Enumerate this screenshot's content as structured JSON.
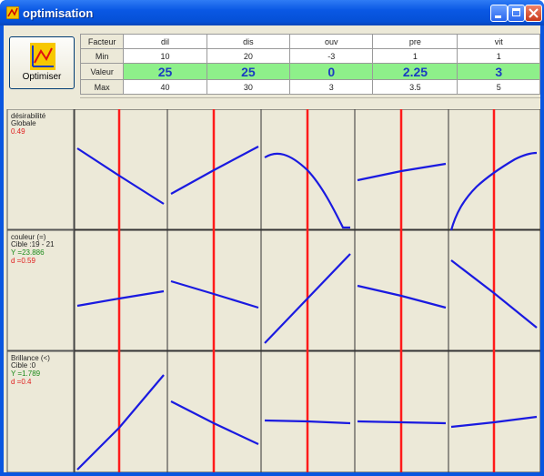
{
  "window": {
    "title": "optimisation"
  },
  "optimise_button": {
    "label": "Optimiser"
  },
  "table": {
    "row_headers": {
      "factor": "Facteur",
      "min": "Min",
      "value": "Valeur",
      "max": "Max"
    },
    "columns": [
      {
        "factor": "dil",
        "min": "10",
        "value": "25",
        "max": "40"
      },
      {
        "factor": "dis",
        "min": "20",
        "value": "25",
        "max": "30"
      },
      {
        "factor": "ouv",
        "min": "-3",
        "value": "0",
        "max": "3"
      },
      {
        "factor": "pre",
        "min": "1",
        "value": "2.25",
        "max": "3.5"
      },
      {
        "factor": "vit",
        "min": "1",
        "value": "3",
        "max": "5"
      }
    ]
  },
  "responses": [
    {
      "lines": [
        "désirabilité",
        "Globale"
      ],
      "value": "0.49"
    },
    {
      "lines": [
        "couleur (=)",
        "Cible :19 - 21"
      ],
      "y": "Y =23.886",
      "d": "d =0.59"
    },
    {
      "lines": [
        "Brillance (<)",
        "Cible :0"
      ],
      "y": "Y =1.789",
      "d": "d =0.4"
    }
  ],
  "colors": {
    "curve": "#1a1ae0",
    "marker": "#ff1a1a",
    "value_text": "#e02020",
    "y_text": "#1a8a1a",
    "green_row": "#8ef08a",
    "title_bar": "#0a58e4"
  }
}
